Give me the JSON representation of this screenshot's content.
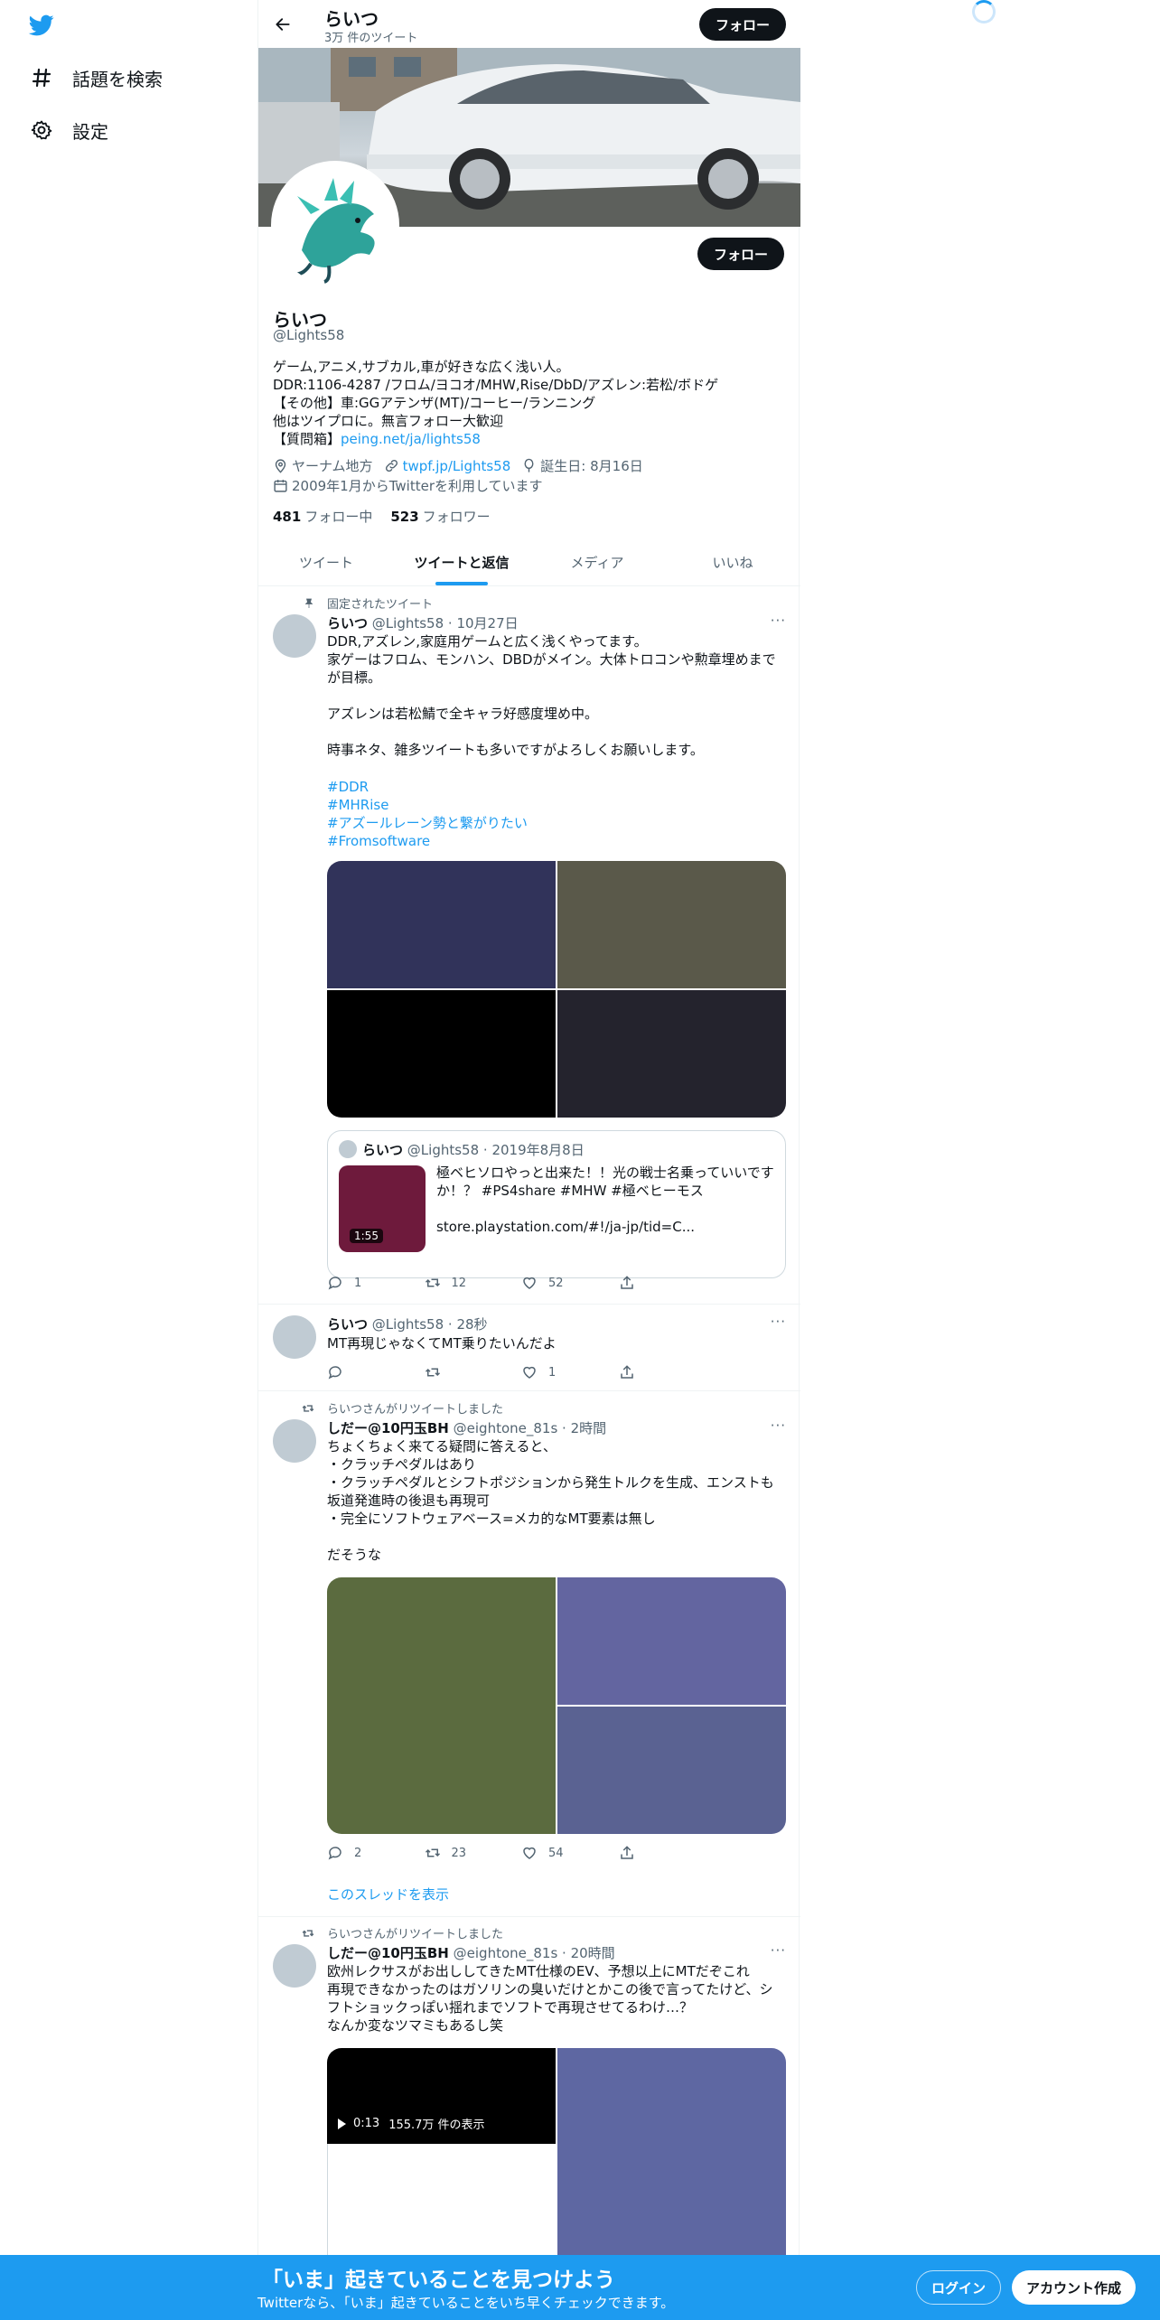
{
  "nav": {
    "explore_label": "話題を検索",
    "settings_label": "設定"
  },
  "header": {
    "name": "らいつ",
    "tweet_count": "3万 件のツイート",
    "follow_label": "フォロー"
  },
  "profile": {
    "name": "らいつ",
    "handle": "@Lights58",
    "follow_label": "フォロー",
    "bio_lines": [
      "ゲーム,アニメ,サブカル,車が好きな広く浅い人。",
      "DDR:1106-4287 /フロム/ヨコオ/MHW,Rise/DbD/アズレン:若松/ボドゲ",
      "【その他】車:GGアテンザ(MT)/コーヒー/ランニング",
      "他はツイプロに。無言フォロー大歓迎"
    ],
    "bio_question_prefix": "【質問箱】",
    "bio_question_link": "peing.net/ja/lights58",
    "location": "ヤーナム地方",
    "website": "twpf.jp/Lights58",
    "birthday": "誕生日: 8月16日",
    "joined": "2009年1月からTwitterを利用しています",
    "following_count": "481",
    "following_label": "フォロー中",
    "followers_count": "523",
    "followers_label": "フォロワー"
  },
  "tabs": [
    {
      "label": "ツイート",
      "active": false
    },
    {
      "label": "ツイートと返信",
      "active": true
    },
    {
      "label": "メディア",
      "active": false
    },
    {
      "label": "いいね",
      "active": false
    }
  ],
  "tweets": [
    {
      "social": "固定されたツイート",
      "name": "らいつ",
      "handle": "@Lights58",
      "time": "10月27日",
      "text": "DDR,アズレン,家庭用ゲームと広く浅くやってます。\n家ゲーはフロム、モンハン、DBDがメイン。大体トロコンや勲章埋めまでが目標。\n\nアズレンは若松鯖で全キャラ好感度埋め中。\n\n時事ネタ、雑多ツイートも多いですがよろしくお願いします。",
      "hashtags": [
        "#DDR",
        "#MHRise",
        "#アズールレーン勢と繋がりたい",
        "#Fromsoftware"
      ],
      "media_colors": [
        "#31335a",
        "#5a594a",
        "#000000",
        "#24232d"
      ],
      "quote": {
        "name": "らいつ",
        "handle": "@Lights58",
        "time": "2019年8月8日",
        "text": "極ベヒソロやっと出来た！！光の戦士名乗っていいですか！？ #PS4share #MHW #極ベヒーモス\n\nstore.playstation.com/#!/ja-jp/tid=C...",
        "duration": "1:55"
      },
      "replies": "1",
      "retweets": "12",
      "likes": "52"
    },
    {
      "name": "らいつ",
      "handle": "@Lights58",
      "time": "28秒",
      "text": "MT再現じゃなくてMT乗りたいんだよ",
      "replies": "",
      "retweets": "",
      "likes": "1"
    },
    {
      "social": "らいつさんがリツイートしました",
      "name": "しだー@10円玉BH",
      "handle": "@eightone_81s",
      "time": "2時間",
      "text": "ちょくちょく来てる疑問に答えると、\n・クラッチペダルはあり\n・クラッチペダルとシフトポジションから発生トルクを生成、エンストも坂道発進時の後退も再現可\n・完全にソフトウェアベース=メカ的なMT要素は無し\n\nだそうな",
      "media_colors": [
        "#5b6b3f",
        "#6365a0",
        "#5a6292"
      ],
      "replies": "2",
      "retweets": "23",
      "likes": "54",
      "thread_link": "このスレッドを表示"
    },
    {
      "social": "らいつさんがリツイートしました",
      "name": "しだー@10円玉BH",
      "handle": "@eightone_81s",
      "time": "20時間",
      "text": "欧州レクサスがお出ししてきたMT仕様のEV、予想以上にMTだぞこれ\n再現できなかったのはガソリンの臭いだけとかこの後で言ってたけど、シフトショックっぽい揺れまでソフトで再現させてるわけ…？\nなんか変なツマミもあるし笑",
      "media_colors": [
        "#000000",
        "#ffffff",
        "#5e67a2"
      ],
      "video_time": "0:13",
      "video_views": "155.7万 件の表示"
    }
  ],
  "bottom_bar": {
    "title": "「いま」起きていることを見つけよう",
    "subtitle": "Twitterなら、「いま」起きていることをいち早くチェックできます。",
    "login_label": "ログイン",
    "signup_label": "アカウント作成"
  },
  "colors": {
    "accent": "#1d9bf0",
    "text": "#0f1419",
    "secondary": "#536471"
  }
}
